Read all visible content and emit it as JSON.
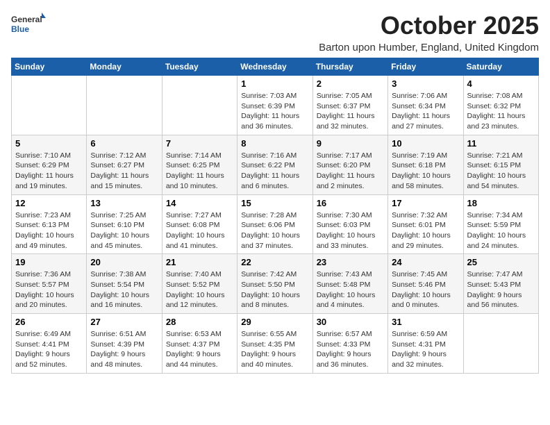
{
  "header": {
    "logo_general": "General",
    "logo_blue": "Blue",
    "month": "October 2025",
    "location": "Barton upon Humber, England, United Kingdom"
  },
  "weekdays": [
    "Sunday",
    "Monday",
    "Tuesday",
    "Wednesday",
    "Thursday",
    "Friday",
    "Saturday"
  ],
  "weeks": [
    [
      {
        "day": "",
        "info": ""
      },
      {
        "day": "",
        "info": ""
      },
      {
        "day": "",
        "info": ""
      },
      {
        "day": "1",
        "info": "Sunrise: 7:03 AM\nSunset: 6:39 PM\nDaylight: 11 hours\nand 36 minutes."
      },
      {
        "day": "2",
        "info": "Sunrise: 7:05 AM\nSunset: 6:37 PM\nDaylight: 11 hours\nand 32 minutes."
      },
      {
        "day": "3",
        "info": "Sunrise: 7:06 AM\nSunset: 6:34 PM\nDaylight: 11 hours\nand 27 minutes."
      },
      {
        "day": "4",
        "info": "Sunrise: 7:08 AM\nSunset: 6:32 PM\nDaylight: 11 hours\nand 23 minutes."
      }
    ],
    [
      {
        "day": "5",
        "info": "Sunrise: 7:10 AM\nSunset: 6:29 PM\nDaylight: 11 hours\nand 19 minutes."
      },
      {
        "day": "6",
        "info": "Sunrise: 7:12 AM\nSunset: 6:27 PM\nDaylight: 11 hours\nand 15 minutes."
      },
      {
        "day": "7",
        "info": "Sunrise: 7:14 AM\nSunset: 6:25 PM\nDaylight: 11 hours\nand 10 minutes."
      },
      {
        "day": "8",
        "info": "Sunrise: 7:16 AM\nSunset: 6:22 PM\nDaylight: 11 hours\nand 6 minutes."
      },
      {
        "day": "9",
        "info": "Sunrise: 7:17 AM\nSunset: 6:20 PM\nDaylight: 11 hours\nand 2 minutes."
      },
      {
        "day": "10",
        "info": "Sunrise: 7:19 AM\nSunset: 6:18 PM\nDaylight: 10 hours\nand 58 minutes."
      },
      {
        "day": "11",
        "info": "Sunrise: 7:21 AM\nSunset: 6:15 PM\nDaylight: 10 hours\nand 54 minutes."
      }
    ],
    [
      {
        "day": "12",
        "info": "Sunrise: 7:23 AM\nSunset: 6:13 PM\nDaylight: 10 hours\nand 49 minutes."
      },
      {
        "day": "13",
        "info": "Sunrise: 7:25 AM\nSunset: 6:10 PM\nDaylight: 10 hours\nand 45 minutes."
      },
      {
        "day": "14",
        "info": "Sunrise: 7:27 AM\nSunset: 6:08 PM\nDaylight: 10 hours\nand 41 minutes."
      },
      {
        "day": "15",
        "info": "Sunrise: 7:28 AM\nSunset: 6:06 PM\nDaylight: 10 hours\nand 37 minutes."
      },
      {
        "day": "16",
        "info": "Sunrise: 7:30 AM\nSunset: 6:03 PM\nDaylight: 10 hours\nand 33 minutes."
      },
      {
        "day": "17",
        "info": "Sunrise: 7:32 AM\nSunset: 6:01 PM\nDaylight: 10 hours\nand 29 minutes."
      },
      {
        "day": "18",
        "info": "Sunrise: 7:34 AM\nSunset: 5:59 PM\nDaylight: 10 hours\nand 24 minutes."
      }
    ],
    [
      {
        "day": "19",
        "info": "Sunrise: 7:36 AM\nSunset: 5:57 PM\nDaylight: 10 hours\nand 20 minutes."
      },
      {
        "day": "20",
        "info": "Sunrise: 7:38 AM\nSunset: 5:54 PM\nDaylight: 10 hours\nand 16 minutes."
      },
      {
        "day": "21",
        "info": "Sunrise: 7:40 AM\nSunset: 5:52 PM\nDaylight: 10 hours\nand 12 minutes."
      },
      {
        "day": "22",
        "info": "Sunrise: 7:42 AM\nSunset: 5:50 PM\nDaylight: 10 hours\nand 8 minutes."
      },
      {
        "day": "23",
        "info": "Sunrise: 7:43 AM\nSunset: 5:48 PM\nDaylight: 10 hours\nand 4 minutes."
      },
      {
        "day": "24",
        "info": "Sunrise: 7:45 AM\nSunset: 5:46 PM\nDaylight: 10 hours\nand 0 minutes."
      },
      {
        "day": "25",
        "info": "Sunrise: 7:47 AM\nSunset: 5:43 PM\nDaylight: 9 hours\nand 56 minutes."
      }
    ],
    [
      {
        "day": "26",
        "info": "Sunrise: 6:49 AM\nSunset: 4:41 PM\nDaylight: 9 hours\nand 52 minutes."
      },
      {
        "day": "27",
        "info": "Sunrise: 6:51 AM\nSunset: 4:39 PM\nDaylight: 9 hours\nand 48 minutes."
      },
      {
        "day": "28",
        "info": "Sunrise: 6:53 AM\nSunset: 4:37 PM\nDaylight: 9 hours\nand 44 minutes."
      },
      {
        "day": "29",
        "info": "Sunrise: 6:55 AM\nSunset: 4:35 PM\nDaylight: 9 hours\nand 40 minutes."
      },
      {
        "day": "30",
        "info": "Sunrise: 6:57 AM\nSunset: 4:33 PM\nDaylight: 9 hours\nand 36 minutes."
      },
      {
        "day": "31",
        "info": "Sunrise: 6:59 AM\nSunset: 4:31 PM\nDaylight: 9 hours\nand 32 minutes."
      },
      {
        "day": "",
        "info": ""
      }
    ]
  ]
}
